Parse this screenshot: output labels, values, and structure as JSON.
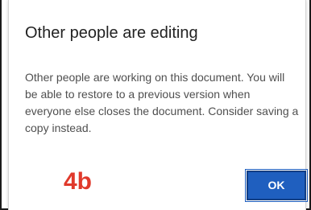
{
  "dialog": {
    "title": "Other people are editing",
    "message": "Other people are working on this document. You will be able to restore to a previous version when everyone else closes the document. Consider saving a copy instead.",
    "ok_label": "OK"
  },
  "annotation": {
    "label": "4b",
    "color": "#e0392b"
  },
  "colors": {
    "accent": "#1f5fbf",
    "title_text": "#222222",
    "message_text": "#4f4f4f"
  }
}
